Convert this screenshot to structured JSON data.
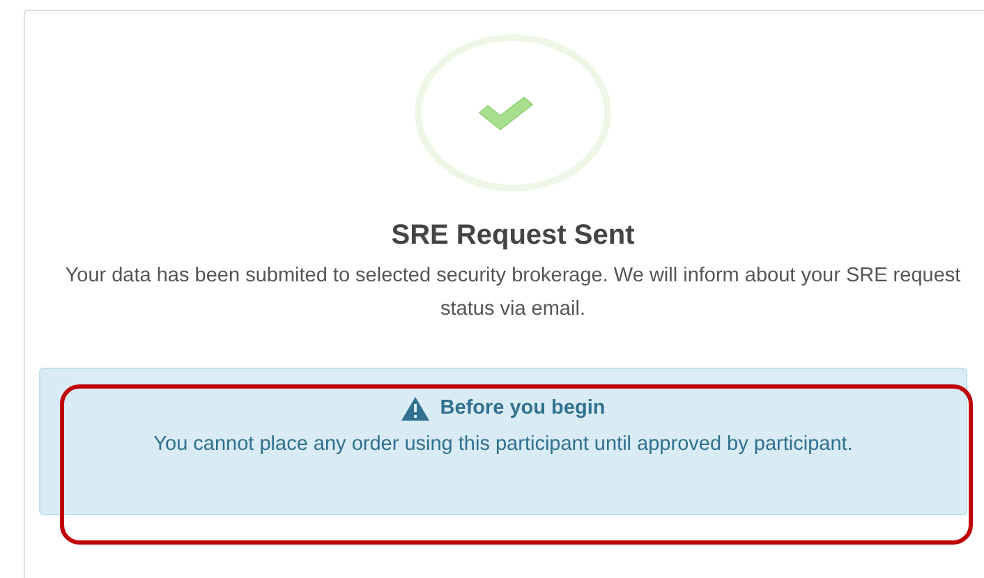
{
  "status": {
    "title": "SRE Request Sent",
    "message": "Your data has been submited to selected security brokerage. We will inform about your SRE request status via email."
  },
  "notice": {
    "title": "Before you begin",
    "message": "You cannot place any order using this participant until approved by participant.",
    "highlighted": true
  }
}
